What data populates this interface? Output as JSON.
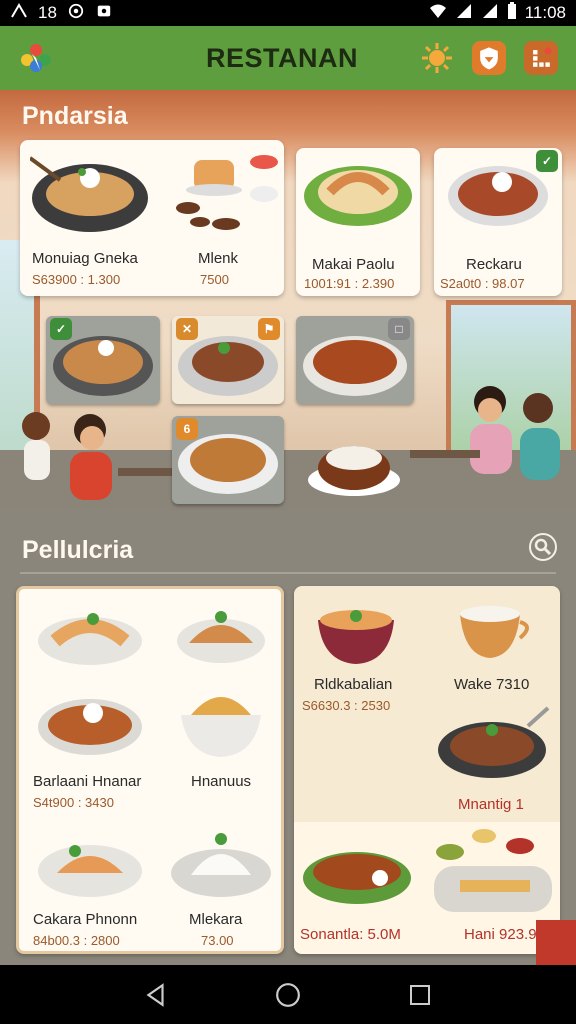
{
  "status_bar": {
    "notification_count": "18",
    "time": "11:08"
  },
  "app": {
    "title": "RESTANAN",
    "accent": "#5f9e3f"
  },
  "featured": {
    "title": "Pndarsia",
    "cards": [
      {
        "name": "Monuiag Gneka",
        "price": "S63900 : 1.300"
      },
      {
        "name": "Mlenk",
        "price": "7500"
      },
      {
        "name": "Makai Paolu",
        "price": "1001:91 : 2.390"
      },
      {
        "name": "Reckaru",
        "price": "S2a0t0 : 98.07"
      }
    ],
    "photo_badges": [
      "6"
    ]
  },
  "popular": {
    "title": "Pellulcria",
    "left_items": [
      {
        "name": "Barlaani Hnanar",
        "price": "S4t900 : 3430"
      },
      {
        "name": "Hnanuus",
        "price": ""
      },
      {
        "name": "Cakara Phnonn",
        "price": "84b00.3 : 2800"
      },
      {
        "name": "Mlekara",
        "price": "73.00"
      }
    ],
    "right_items": [
      {
        "name": "Rldkabalian",
        "price": "S6630.3 : 2530"
      },
      {
        "name": "Wake 7310",
        "price": ""
      },
      {
        "name": "Mnantig 1",
        "price": ""
      },
      {
        "name": "Sonantla: 5.0M",
        "price": ""
      },
      {
        "name": "Hani 923.90",
        "price": ""
      }
    ]
  }
}
